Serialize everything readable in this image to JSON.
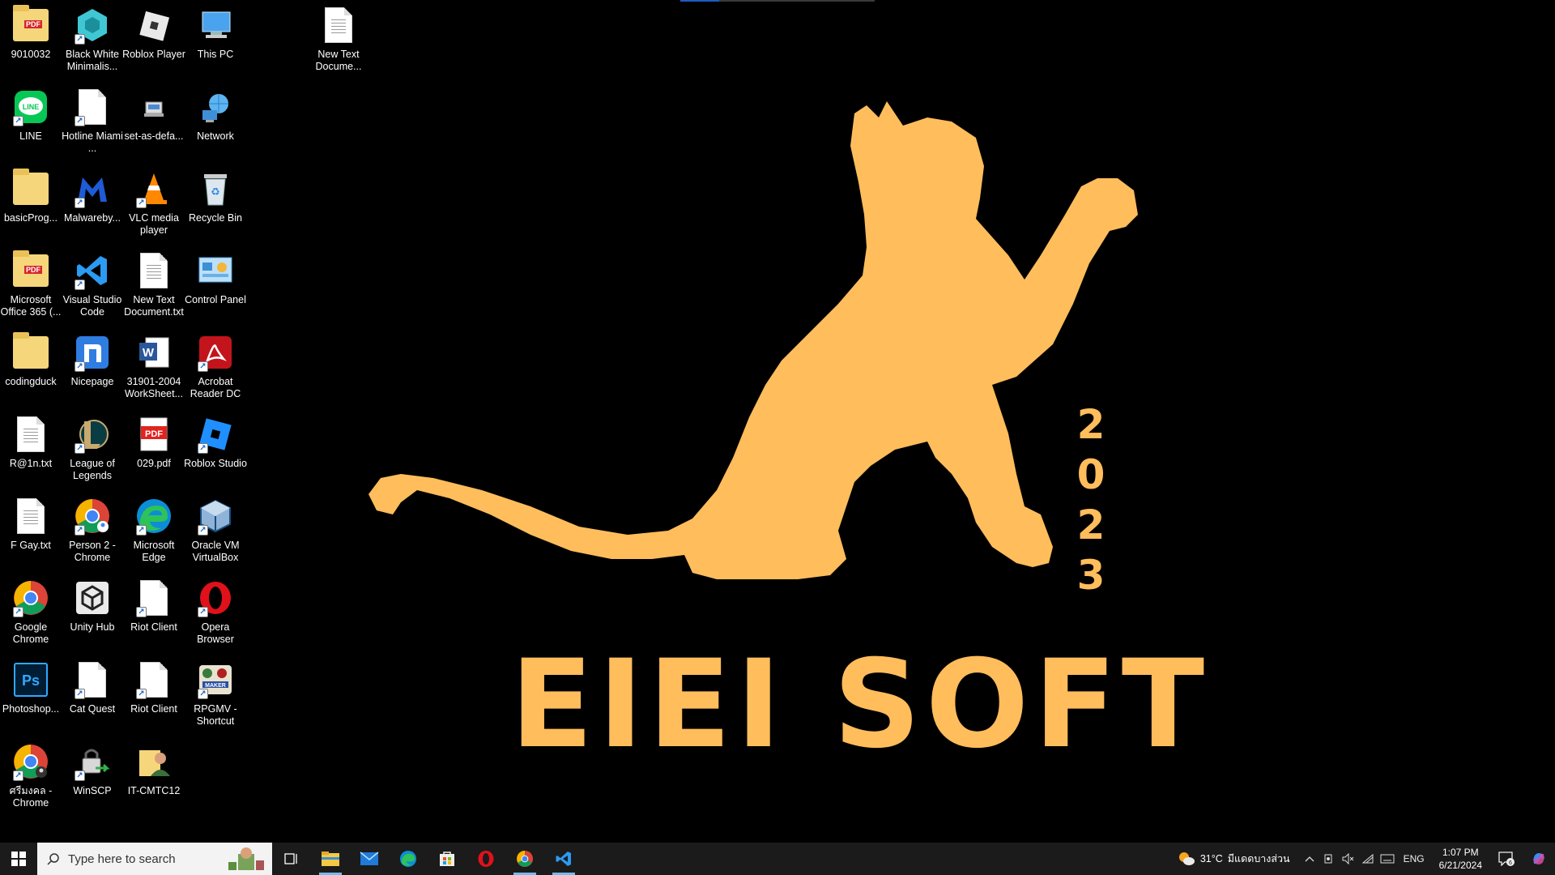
{
  "desktop": {
    "wallpaper": {
      "brand": "EIEI SOFT",
      "year_digits": [
        "2",
        "0",
        "2",
        "3"
      ],
      "accent_color": "#ffbd5c"
    },
    "icons": [
      {
        "label": "9010032",
        "icon": "pdf-folder-icon"
      },
      {
        "label": "Black White Minimalis...",
        "icon": "cube-logo-icon"
      },
      {
        "label": "Roblox Player",
        "icon": "roblox-icon"
      },
      {
        "label": "This PC",
        "icon": "computer-icon"
      },
      {
        "label": "New Text Docume...",
        "icon": "text-document-icon"
      },
      {
        "label": "LINE",
        "icon": "line-app-icon"
      },
      {
        "label": "Hotline Miami ...",
        "icon": "document-icon"
      },
      {
        "label": "set-as-defa...",
        "icon": "setup-icon"
      },
      {
        "label": "Network",
        "icon": "network-globe-icon"
      },
      {
        "label": "basicProg...",
        "icon": "folder-icon"
      },
      {
        "label": "Malwareby...",
        "icon": "malwarebytes-icon"
      },
      {
        "label": "VLC media player",
        "icon": "vlc-cone-icon"
      },
      {
        "label": "Recycle Bin",
        "icon": "recycle-bin-icon"
      },
      {
        "label": "Microsoft Office 365 (...",
        "icon": "pdf-folder-icon"
      },
      {
        "label": "Visual Studio Code",
        "icon": "vscode-icon"
      },
      {
        "label": "New Text Document.txt",
        "icon": "text-document-icon"
      },
      {
        "label": "Control Panel",
        "icon": "control-panel-icon"
      },
      {
        "label": "codingduck",
        "icon": "folder-icon"
      },
      {
        "label": "Nicepage",
        "icon": "nicepage-icon"
      },
      {
        "label": "31901-2004 WorkSheet...",
        "icon": "word-document-icon"
      },
      {
        "label": "Acrobat Reader DC",
        "icon": "acrobat-icon"
      },
      {
        "label": "R@1n.txt",
        "icon": "text-document-icon"
      },
      {
        "label": "League of Legends",
        "icon": "league-icon"
      },
      {
        "label": "029.pdf",
        "icon": "pdf-file-icon"
      },
      {
        "label": "Roblox Studio",
        "icon": "roblox-studio-icon"
      },
      {
        "label": "F Gay.txt",
        "icon": "text-document-icon"
      },
      {
        "label": "Person 2 - Chrome",
        "icon": "chrome-profile-icon"
      },
      {
        "label": "Microsoft Edge",
        "icon": "edge-icon"
      },
      {
        "label": "Oracle VM VirtualBox",
        "icon": "virtualbox-icon"
      },
      {
        "label": "Google Chrome",
        "icon": "chrome-icon"
      },
      {
        "label": "Unity Hub",
        "icon": "unity-icon"
      },
      {
        "label": "Riot Client",
        "icon": "document-icon"
      },
      {
        "label": "Opera Browser",
        "icon": "opera-icon"
      },
      {
        "label": "Photoshop...",
        "icon": "photoshop-icon"
      },
      {
        "label": "Cat Quest",
        "icon": "document-icon"
      },
      {
        "label": "Riot Client",
        "icon": "document-icon"
      },
      {
        "label": "RPGMV - Shortcut",
        "icon": "rpgmaker-icon"
      },
      {
        "label": "ศรีมงคล - Chrome",
        "icon": "chrome-profile-icon"
      },
      {
        "label": "WinSCP",
        "icon": "winscp-icon"
      },
      {
        "label": "IT-CMTC12",
        "icon": "user-folder-icon"
      }
    ]
  },
  "taskbar": {
    "search_placeholder": "Type here to search",
    "apps": [
      {
        "name": "task-view",
        "icon": "task-view-icon"
      },
      {
        "name": "file-explorer",
        "icon": "folder-icon",
        "active": true
      },
      {
        "name": "mail",
        "icon": "mail-icon"
      },
      {
        "name": "edge",
        "icon": "edge-icon"
      },
      {
        "name": "store",
        "icon": "store-icon"
      },
      {
        "name": "opera",
        "icon": "opera-icon"
      },
      {
        "name": "chrome",
        "icon": "chrome-icon",
        "active": true
      },
      {
        "name": "vscode",
        "icon": "vscode-icon",
        "active": true
      }
    ],
    "weather": {
      "temp": "31°C",
      "condition": "มีแดดบางส่วน"
    },
    "language": "ENG",
    "time": "1:07 PM",
    "date": "6/21/2024",
    "notification_count": "6"
  }
}
